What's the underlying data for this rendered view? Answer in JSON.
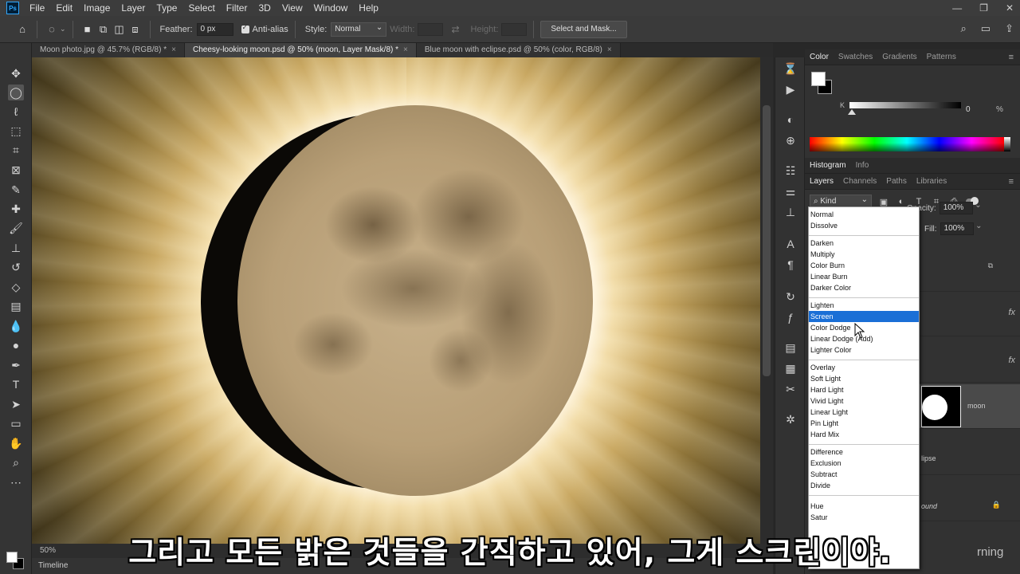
{
  "app": {
    "logo": "Ps"
  },
  "menu": [
    "File",
    "Edit",
    "Image",
    "Layer",
    "Type",
    "Select",
    "Filter",
    "3D",
    "View",
    "Window",
    "Help"
  ],
  "options": {
    "feather_label": "Feather:",
    "feather_value": "0 px",
    "antialias_label": "Anti-alias",
    "style_label": "Style:",
    "style_value": "Normal",
    "width_label": "Width:",
    "height_label": "Height:",
    "select_mask": "Select and Mask..."
  },
  "tabs": [
    {
      "label": "Moon photo.jpg @ 45.7% (RGB/8) *"
    },
    {
      "label": "Cheesy-looking moon.psd @ 50% (moon, Layer Mask/8) *"
    },
    {
      "label": "Blue moon with eclipse.psd @ 50% (color, RGB/8)"
    }
  ],
  "status": {
    "zoom": "50%",
    "timeline": "Timeline"
  },
  "color_panel": {
    "tabs": [
      "Color",
      "Swatches",
      "Gradients",
      "Patterns"
    ],
    "k_label": "K",
    "k_value": "0",
    "k_unit": "%"
  },
  "panel2_tabs": [
    "Histogram",
    "Info"
  ],
  "layers_panel": {
    "tabs": [
      "Layers",
      "Channels",
      "Paths",
      "Libraries"
    ],
    "kind": "Kind",
    "opacity_label": "Opacity:",
    "opacity_value": "100%",
    "fill_label": "Fill:",
    "fill_value": "100%",
    "fx_label": "fx",
    "moon_layer": "moon",
    "eclipse_layer_fragment": "lipse",
    "background_fragment": "ound"
  },
  "blend_modes": [
    [
      "Normal",
      "Dissolve"
    ],
    [
      "Darken",
      "Multiply",
      "Color Burn",
      "Linear Burn",
      "Darker Color"
    ],
    [
      "Lighten",
      "Screen",
      "Color Dodge",
      "Linear Dodge (Add)",
      "Lighter Color"
    ],
    [
      "Overlay",
      "Soft Light",
      "Hard Light",
      "Vivid Light",
      "Linear Light",
      "Pin Light",
      "Hard Mix"
    ],
    [
      "Difference",
      "Exclusion",
      "Subtract",
      "Divide"
    ],
    [
      "Hue",
      "Satur"
    ]
  ],
  "blend_selected": "Screen",
  "subtitle": "그리고 모든 밝은 것들을 간직하고 있어, 그게 스크린이야.",
  "watermark": "rning"
}
